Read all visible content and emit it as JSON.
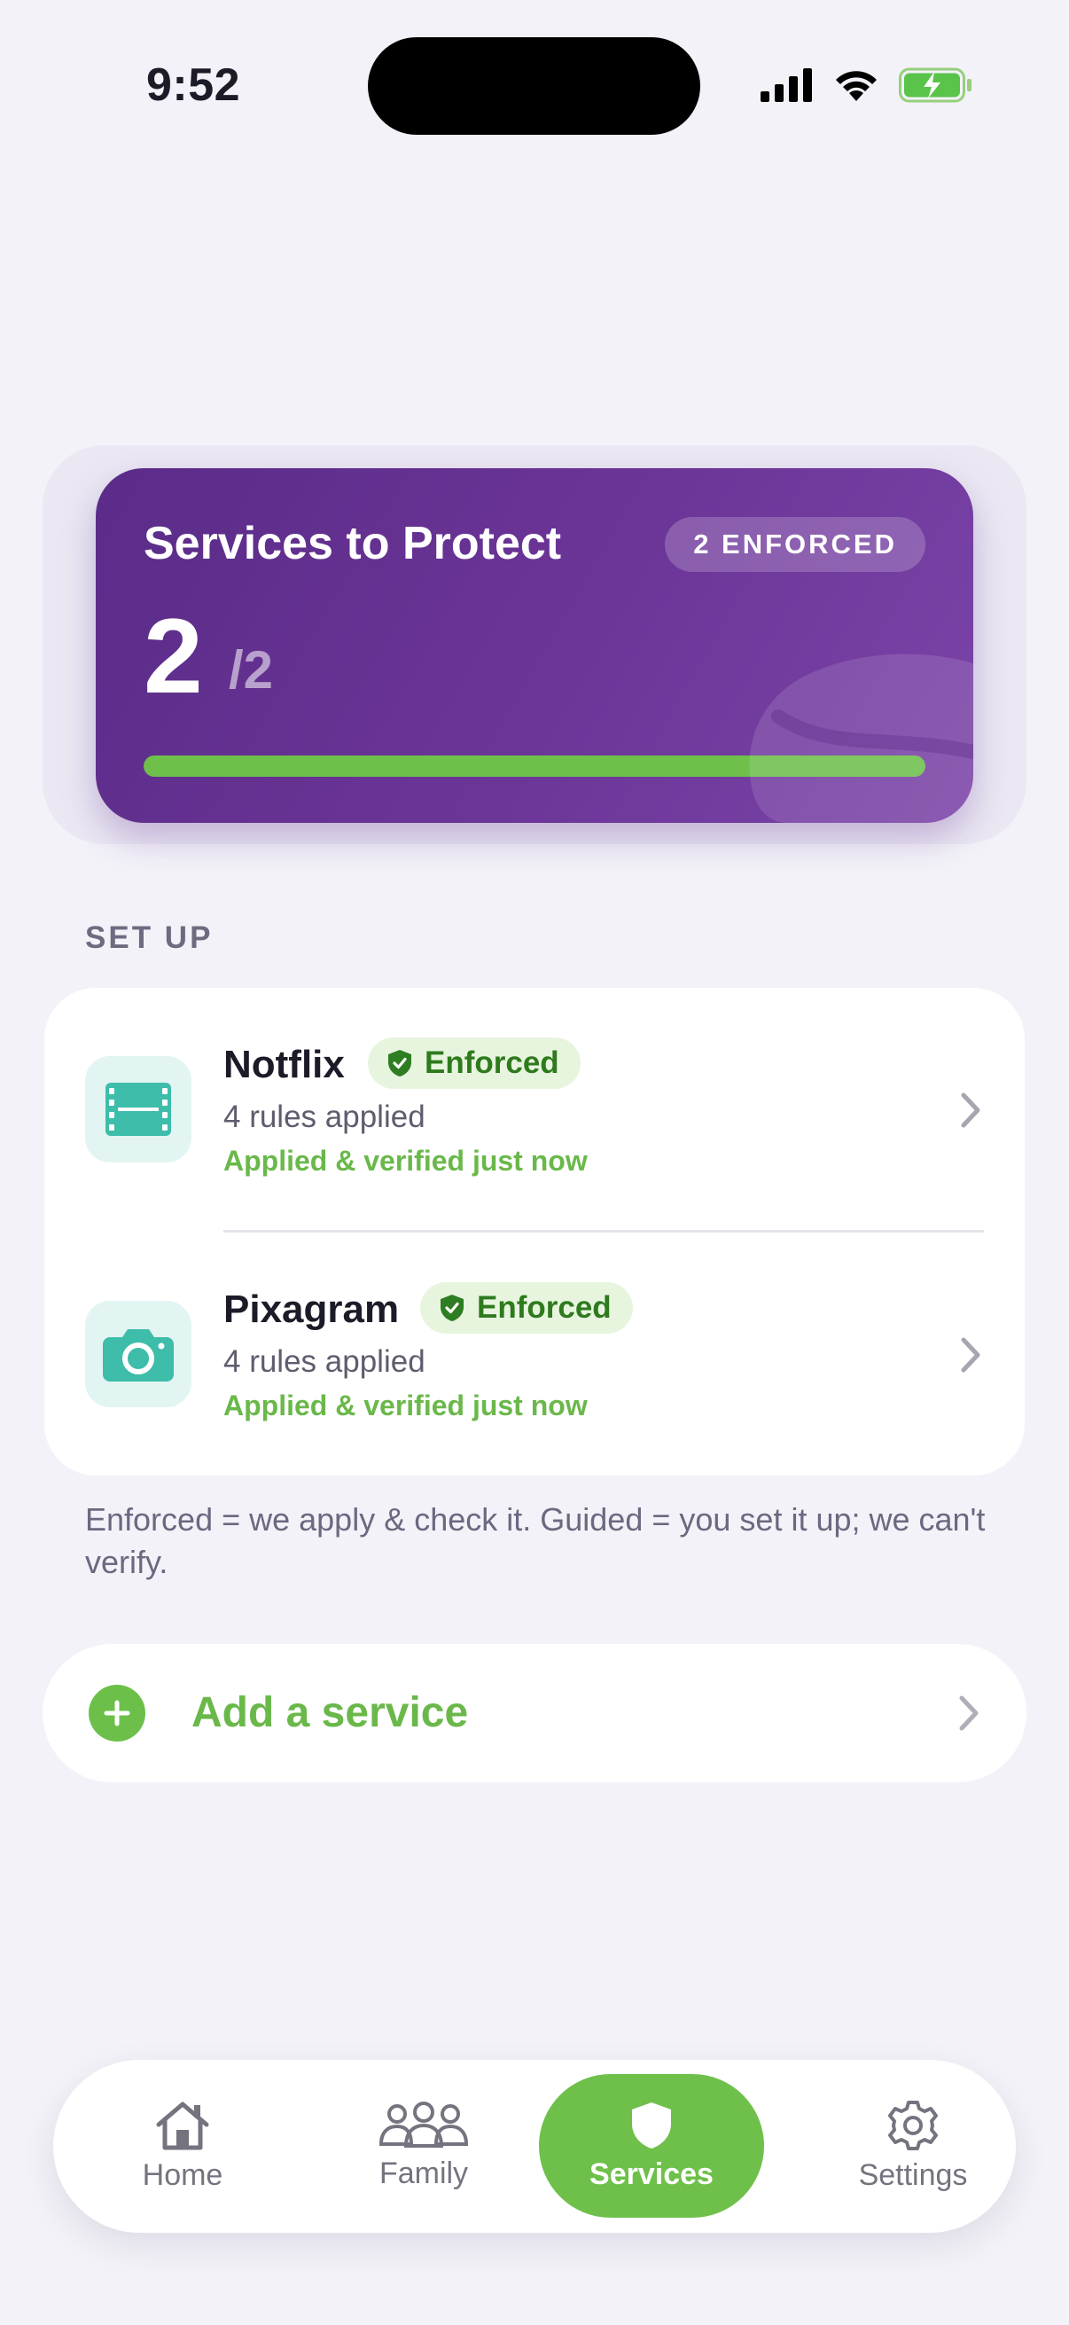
{
  "status": {
    "time": "9:52"
  },
  "hero": {
    "title": "Services to Protect",
    "badge": "2 ENFORCED",
    "count": "2",
    "total": "/2",
    "progress_fraction": 1.0
  },
  "section": {
    "label": "SET UP"
  },
  "services": [
    {
      "name": "Notflix",
      "badge": "Enforced",
      "rules": "4 rules applied",
      "verified": "Applied & verified just now",
      "icon": "film-icon"
    },
    {
      "name": "Pixagram",
      "badge": "Enforced",
      "rules": "4 rules applied",
      "verified": "Applied & verified just now",
      "icon": "camera-icon"
    }
  ],
  "footnote": "Enforced = we apply & check it. Guided = you set it up; we can't verify.",
  "add": {
    "label": "Add a service"
  },
  "tabs": [
    {
      "label": "Home",
      "icon": "home-icon"
    },
    {
      "label": "Family",
      "icon": "family-icon"
    },
    {
      "label": "Services",
      "icon": "shield-icon",
      "active": true
    },
    {
      "label": "Settings",
      "icon": "gear-icon"
    }
  ],
  "colors": {
    "accent": "#6ec04a",
    "hero": "#6a3496",
    "teal": "#3dbdaa"
  }
}
